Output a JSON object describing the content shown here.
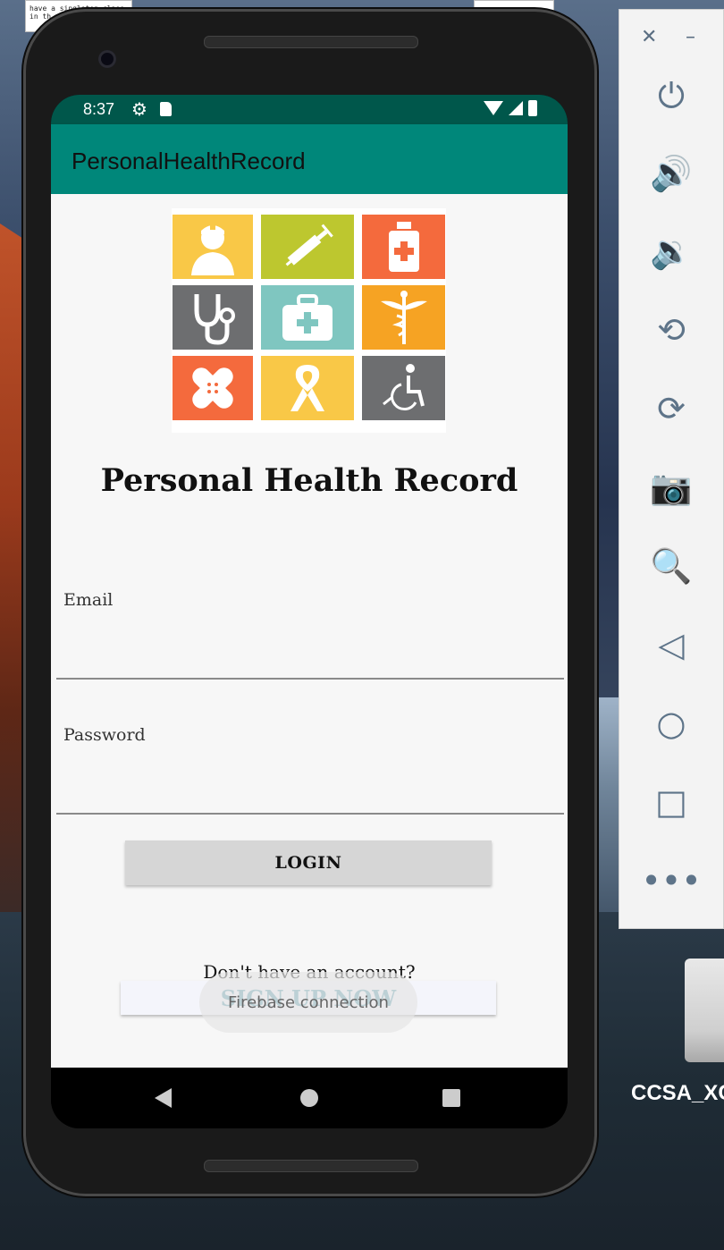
{
  "status_bar": {
    "time": "8:37"
  },
  "app_bar": {
    "title": "PersonalHealthRecord"
  },
  "logo": {
    "tiles": [
      {
        "icon": "doctor-icon",
        "color": "#f9c847"
      },
      {
        "icon": "syringe-icon",
        "color": "#bdc72f"
      },
      {
        "icon": "medicine-bottle-icon",
        "color": "#f46a3d"
      },
      {
        "icon": "stethoscope-icon",
        "color": "#6d6e70"
      },
      {
        "icon": "first-aid-kit-icon",
        "color": "#7fc6c0"
      },
      {
        "icon": "caduceus-icon",
        "color": "#f6a323"
      },
      {
        "icon": "bandage-icon",
        "color": "#f46a3d"
      },
      {
        "icon": "awareness-ribbon-icon",
        "color": "#f9c847"
      },
      {
        "icon": "wheelchair-icon",
        "color": "#6d6e70"
      }
    ]
  },
  "main": {
    "heading": "Personal Health Record",
    "email_label": "Email",
    "password_label": "Password",
    "login_label": "LOGIN",
    "no_account_text": "Don't have an account?",
    "signup_label": "SIGN UP NOW",
    "toast_text": "Firebase connection"
  },
  "desktop": {
    "doc_text": "have a singleton class in th",
    "drive_label": "CCSA_XC -US"
  },
  "colors": {
    "status_bar": "#00574b",
    "app_bar": "#00877a",
    "signup_text": "#5d9fb0"
  }
}
